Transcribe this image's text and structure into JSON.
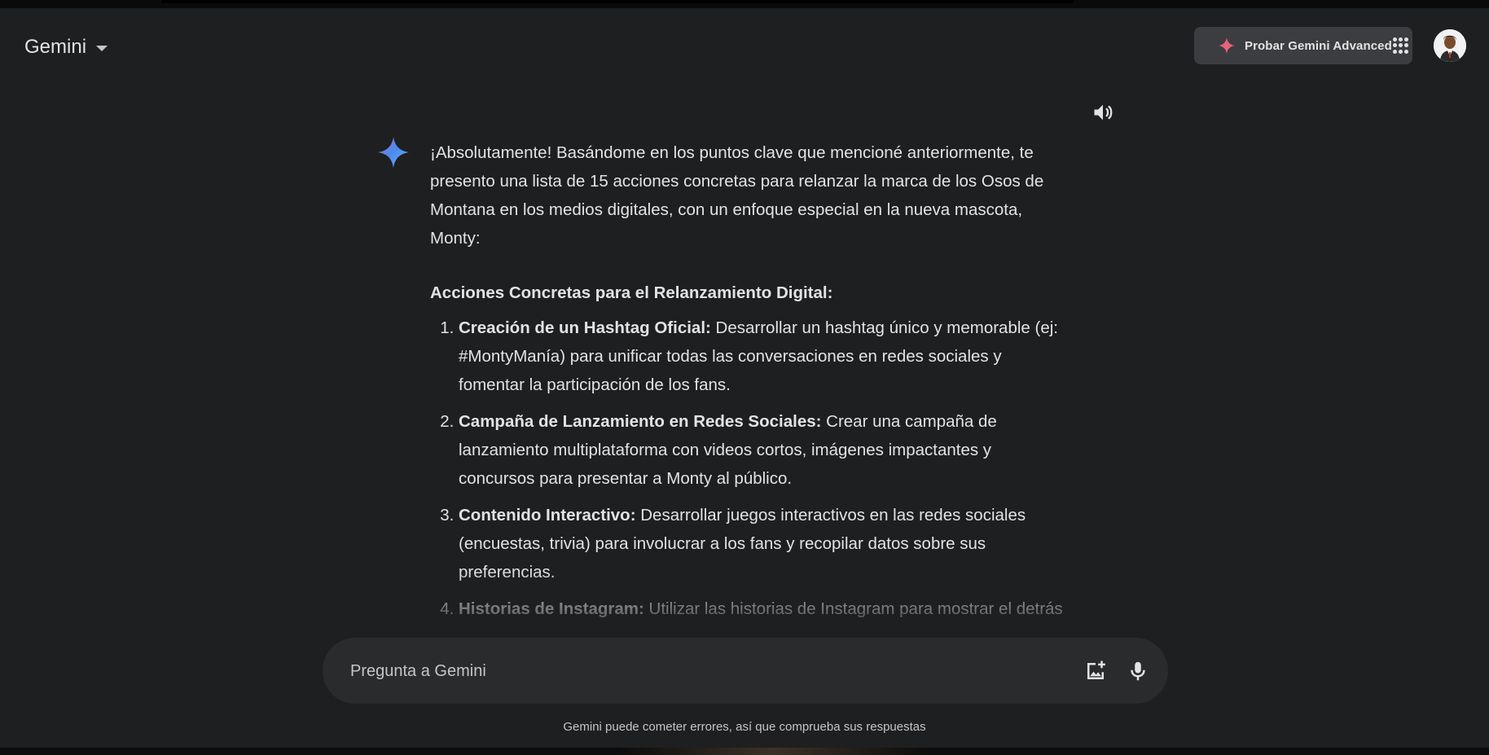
{
  "header": {
    "app_title": "Gemini",
    "upgrade_label": "Probar Gemini Advanced"
  },
  "response": {
    "intro": "¡Absolutamente! Basándome en los puntos clave que mencioné anteriormente, te presento una lista de 15 acciones concretas para relanzar la marca de los Osos de Montana en los medios digitales, con un enfoque especial en la nueva mascota, Monty:",
    "heading": "Acciones Concretas para el Relanzamiento Digital:",
    "items": [
      {
        "title": "Creación de un Hashtag Oficial:",
        "text": " Desarrollar un hashtag único y memorable (ej: #MontyManía) para unificar todas las conversaciones en redes sociales y fomentar la participación de los fans."
      },
      {
        "title": "Campaña de Lanzamiento en Redes Sociales:",
        "text": " Crear una campaña de lanzamiento multiplataforma con videos cortos, imágenes impactantes y concursos para presentar a Monty al público."
      },
      {
        "title": "Contenido Interactivo:",
        "text": " Desarrollar juegos interactivos en las redes sociales (encuestas, trivia) para involucrar a los fans y recopilar datos sobre sus preferencias."
      },
      {
        "title": "Historias de Instagram:",
        "text": " Utilizar las historias de Instagram para mostrar el detrás de cámaras de los eventos del equipo, entrevistas a jugadores y momentos"
      }
    ]
  },
  "input": {
    "placeholder": "Pregunta a Gemini"
  },
  "footer": {
    "disclaimer": "Gemini puede cometer errores, así que comprueba sus respuestas"
  },
  "icons": {
    "brand_star": "gemini-star-icon",
    "upgrade_spark": "sparkle-icon",
    "apps": "apps-grid-icon",
    "speaker": "speaker-icon",
    "image_upload": "add-image-icon",
    "mic": "microphone-icon"
  },
  "colors": {
    "background": "#1e1f20",
    "input_background": "#2a2b2d",
    "upgrade_background": "#3c3d40",
    "spark_pink": "#e8637a",
    "star_blue": "#4a8cf0"
  }
}
